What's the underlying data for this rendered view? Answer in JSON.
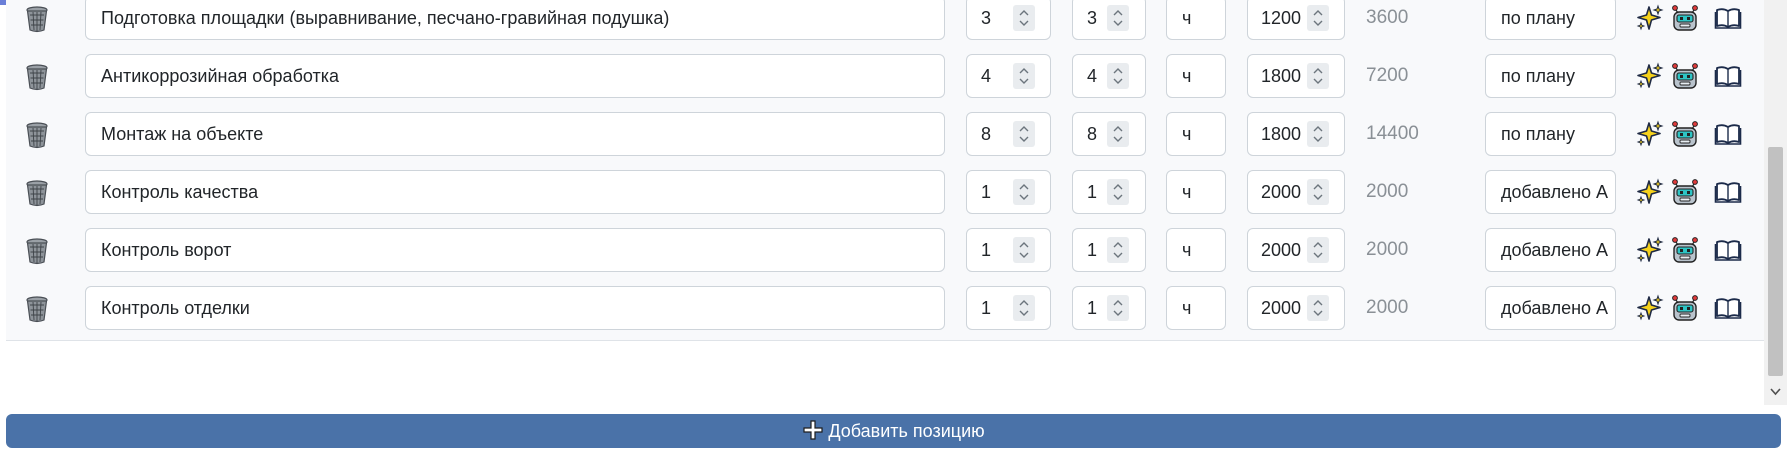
{
  "rows": [
    {
      "name": "Подготовка площадки (выравнивание, песчано-гравийная подушка)",
      "qty1": "3",
      "qty2": "3",
      "unit": "ч",
      "price": "1200",
      "total": "3600",
      "note": "по плану"
    },
    {
      "name": "Антикоррозийная обработка",
      "qty1": "4",
      "qty2": "4",
      "unit": "ч",
      "price": "1800",
      "total": "7200",
      "note": "по плану"
    },
    {
      "name": "Монтаж на объекте",
      "qty1": "8",
      "qty2": "8",
      "unit": "ч",
      "price": "1800",
      "total": "14400",
      "note": "по плану"
    },
    {
      "name": "Контроль качества",
      "qty1": "1",
      "qty2": "1",
      "unit": "ч",
      "price": "2000",
      "total": "2000",
      "note": "добавлено А"
    },
    {
      "name": "Контроль ворот",
      "qty1": "1",
      "qty2": "1",
      "unit": "ч",
      "price": "2000",
      "total": "2000",
      "note": "добавлено А"
    },
    {
      "name": "Контроль отделки",
      "qty1": "1",
      "qty2": "1",
      "unit": "ч",
      "price": "2000",
      "total": "2000",
      "note": "добавлено А"
    }
  ],
  "add_button": {
    "label": "Добавить позицию",
    "icon": "plus-icon"
  },
  "icons": {
    "delete": "trash-icon",
    "ai": "sparkle-icon",
    "robot": "robot-icon",
    "docs": "book-icon"
  },
  "colors": {
    "accent": "#4a72a8",
    "row_bg": "#f8f9fb",
    "total_text": "#8a9096"
  }
}
